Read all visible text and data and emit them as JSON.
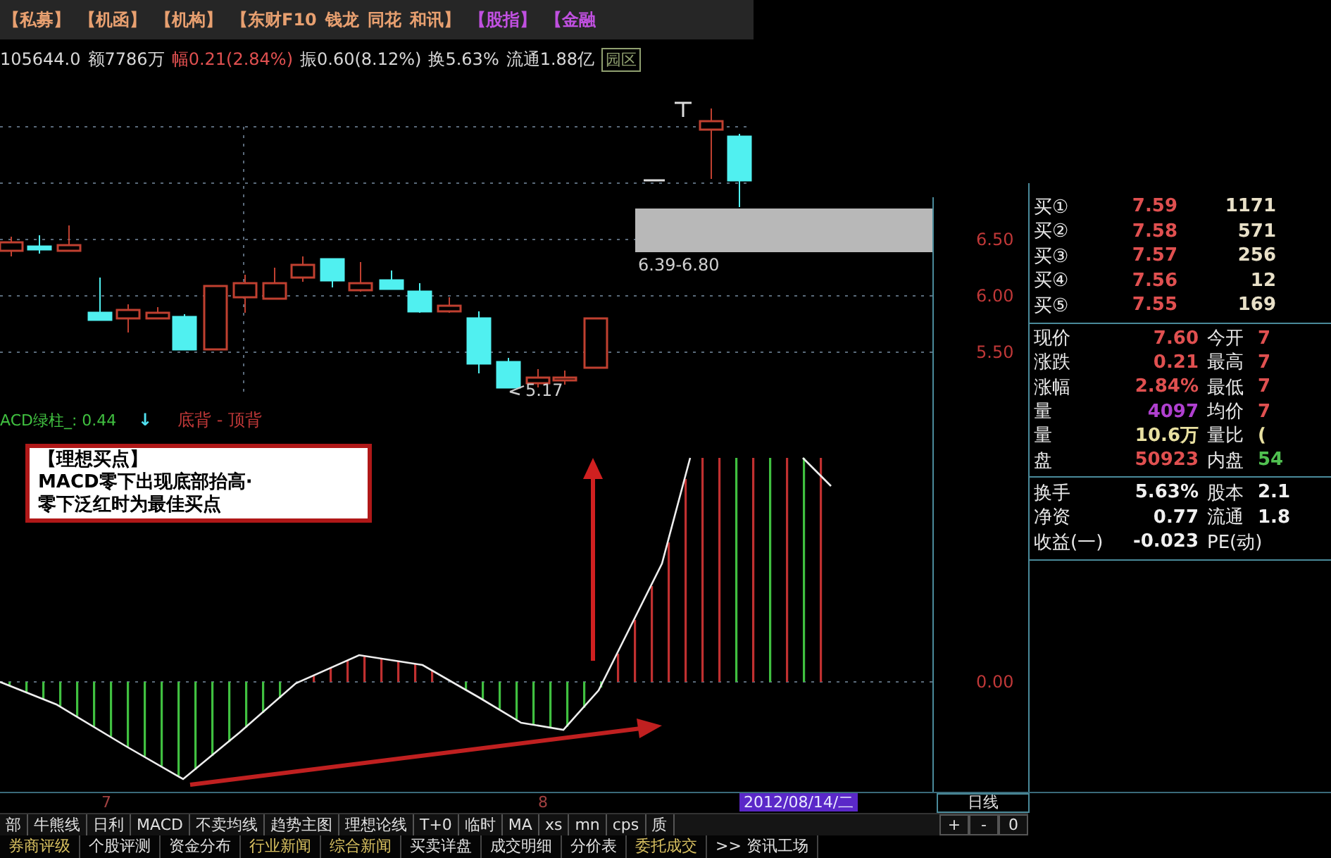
{
  "tabs": [
    {
      "label": "【私募】",
      "color": "#e8a070"
    },
    {
      "label": "【机函】",
      "color": "#e8a070"
    },
    {
      "label": "【机构】",
      "color": "#e8a070"
    },
    {
      "label": "【东财F10",
      "color": "#e8a070"
    },
    {
      "label": "钱龙",
      "color": "#e8a070"
    },
    {
      "label": "同花",
      "color": "#e8a070"
    },
    {
      "label": "和讯】",
      "color": "#e8a070"
    },
    {
      "label": "【股指】",
      "color": "#c050e0"
    },
    {
      "label": "【金融",
      "color": "#c050e0"
    }
  ],
  "info_line": [
    {
      "kind": "text",
      "text": "105644.0",
      "color": "#d8d8d8"
    },
    {
      "kind": "text",
      "text": "额7786万",
      "color": "#d8d8d8"
    },
    {
      "kind": "text",
      "text": "幅0.21(2.84%)",
      "color": "#e05050"
    },
    {
      "kind": "text",
      "text": "振0.60(8.12%)",
      "color": "#d8d8d8"
    },
    {
      "kind": "text",
      "text": "换5.63%",
      "color": "#d8d8d8"
    },
    {
      "kind": "text",
      "text": "流通1.88亿",
      "color": "#d8d8d8"
    },
    {
      "kind": "badge",
      "text": "园区",
      "color": "#90a070"
    }
  ],
  "price_chart": {
    "price_axis": [
      "6.50",
      "6.00",
      "5.50"
    ],
    "range_label": "6.39-6.80",
    "low_label": "5.17"
  },
  "indicator": {
    "name": "ACD绿柱_: 0.44",
    "trend": "↓",
    "signals": "底背 - 顶背",
    "zero_label": "0.00"
  },
  "annotation": {
    "title": "【理想买点】",
    "lines": [
      "MACD零下出现底部抬高·",
      "零下泛红时为最佳买点"
    ]
  },
  "order_book": [
    {
      "label": "买①",
      "price": "7.59",
      "volume": "1171"
    },
    {
      "label": "买②",
      "price": "7.58",
      "volume": "571"
    },
    {
      "label": "买③",
      "price": "7.57",
      "volume": "256"
    },
    {
      "label": "买④",
      "price": "7.56",
      "volume": "12"
    },
    {
      "label": "买⑤",
      "price": "7.55",
      "volume": "169"
    }
  ],
  "quote": [
    [
      {
        "label": "现价",
        "value": "7.60",
        "color": "#e05050"
      },
      {
        "label": "今开",
        "value": "7",
        "color": "#e05050"
      }
    ],
    [
      {
        "label": "涨跌",
        "value": "0.21",
        "color": "#e05050"
      },
      {
        "label": "最高",
        "value": "7",
        "color": "#e05050"
      }
    ],
    [
      {
        "label": "涨幅",
        "value": "2.84%",
        "color": "#e05050"
      },
      {
        "label": "最低",
        "value": "7",
        "color": "#e05050"
      }
    ],
    [
      {
        "label": "量",
        "value": "4097",
        "color": "#b040d0"
      },
      {
        "label": "均价",
        "value": "7",
        "color": "#e05050"
      }
    ],
    [
      {
        "label": "量",
        "value": "10.6万",
        "color": "#e8e0a0"
      },
      {
        "label": "量比",
        "value": "(",
        "color": "#e8e0a0"
      }
    ],
    [
      {
        "label": "盘",
        "value": "50923",
        "color": "#e05050"
      },
      {
        "label": "内盘",
        "value": "54",
        "color": "#50c050"
      }
    ]
  ],
  "stats": [
    {
      "label": "换手",
      "value": "5.63%",
      "label2": "股本",
      "value2": "2.1"
    },
    {
      "label": "净资",
      "value": "0.77",
      "label2": "流通",
      "value2": "1.8"
    },
    {
      "label": "收益(一)",
      "value": "-0.023",
      "label2": "PE(动)"
    }
  ],
  "time_axis": [
    "7",
    "8"
  ],
  "date_badge": "2012/08/14/二",
  "period": "日线",
  "toolbar": [
    {
      "label": "部"
    },
    {
      "label": "牛熊线"
    },
    {
      "label": "日利"
    },
    {
      "label": "MACD"
    },
    {
      "label": "不卖均线"
    },
    {
      "label": "趋势主图"
    },
    {
      "label": "理想论线"
    },
    {
      "label": "T+0"
    },
    {
      "label": "临时"
    },
    {
      "label": "MA"
    },
    {
      "label": "xs"
    },
    {
      "label": "mn"
    },
    {
      "label": "cps"
    },
    {
      "label": "质"
    }
  ],
  "zoom_buttons": [
    "+",
    "-",
    "0"
  ],
  "info_tabs": [
    {
      "label": "券商评级",
      "color": "#d8c060"
    },
    {
      "label": "个股评测",
      "color": "#e0e0e0"
    },
    {
      "label": "资金分布",
      "color": "#e0e0e0"
    },
    {
      "label": "行业新闻",
      "color": "#d8c060"
    },
    {
      "label": "综合新闻",
      "color": "#d8c060"
    },
    {
      "label": "买卖详盘",
      "color": "#e0e0e0"
    },
    {
      "label": "成交明细",
      "color": "#e0e0e0"
    },
    {
      "label": "分价表",
      "color": "#e0e0e0"
    },
    {
      "label": "委托成交",
      "color": "#d8c060"
    },
    {
      "label": ">> 资讯工场",
      "color": "#e0e0e0"
    }
  ]
}
